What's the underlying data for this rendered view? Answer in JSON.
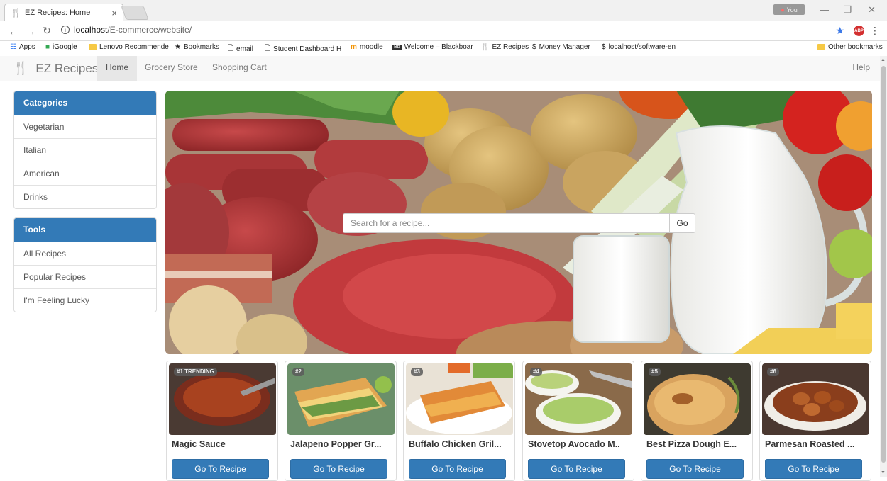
{
  "browser": {
    "tab_title": "EZ Recipes: Home",
    "url_host": "localhost",
    "url_path": "/E-commerce/website/",
    "user_label": "You",
    "bookmarks": [
      {
        "label": "Apps",
        "icon": "apps-grid-icon"
      },
      {
        "label": "iGoogle",
        "icon": "igoogle-icon"
      },
      {
        "label": "Lenovo Recommende",
        "icon": "folder-icon"
      },
      {
        "label": "Bookmarks",
        "icon": "star-icon"
      },
      {
        "label": "email",
        "icon": "page-icon"
      },
      {
        "label": "Student Dashboard H",
        "icon": "page-icon"
      },
      {
        "label": "moodle",
        "icon": "moodle-icon"
      },
      {
        "label": "Welcome – Blackboar",
        "icon": "blackboard-icon"
      },
      {
        "label": "EZ Recipes",
        "icon": "utensils-icon"
      },
      {
        "label": "Money Manager",
        "icon": "dollar-icon"
      },
      {
        "label": "localhost/software-en",
        "icon": "dollar-icon"
      }
    ],
    "other_bookmarks": "Other bookmarks"
  },
  "site": {
    "brand": "EZ Recipes",
    "nav": [
      "Home",
      "Grocery Store",
      "Shopping Cart"
    ],
    "help": "Help"
  },
  "sidebar": {
    "categories": {
      "title": "Categories",
      "items": [
        "Vegetarian",
        "Italian",
        "American",
        "Drinks"
      ]
    },
    "tools": {
      "title": "Tools",
      "items": [
        "All Recipes",
        "Popular Recipes",
        "I'm Feeling Lucky"
      ]
    }
  },
  "search": {
    "placeholder": "Search for a recipe...",
    "button": "Go"
  },
  "recipes": [
    {
      "badge": "#1 TRENDING",
      "title": "Magic Sauce",
      "button": "Go To Recipe"
    },
    {
      "badge": "#2",
      "title": "Jalapeno Popper Gr...",
      "button": "Go To Recipe"
    },
    {
      "badge": "#3",
      "title": "Buffalo Chicken Gril...",
      "button": "Go To Recipe"
    },
    {
      "badge": "#4",
      "title": "Stovetop Avocado M..",
      "button": "Go To Recipe"
    },
    {
      "badge": "#5",
      "title": "Best Pizza Dough E...",
      "button": "Go To Recipe"
    },
    {
      "badge": "#6",
      "title": "Parmesan Roasted ...",
      "button": "Go To Recipe"
    }
  ],
  "colors": {
    "primary": "#337ab7",
    "navbar_bg": "#f8f8f8"
  }
}
